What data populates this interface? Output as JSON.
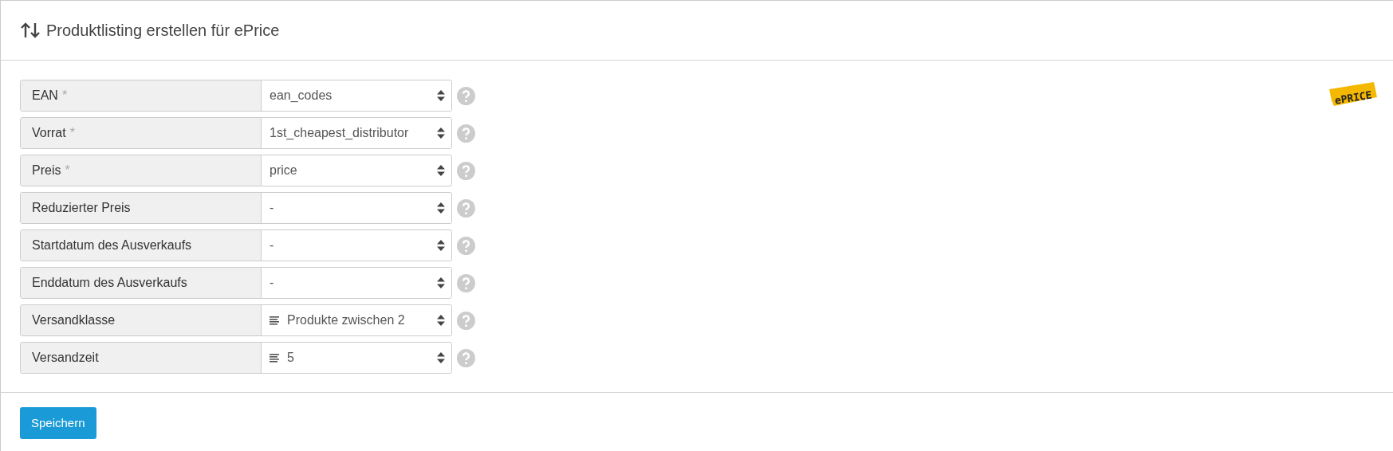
{
  "title": "Produktlisting erstellen für ePrice",
  "logo": {
    "text": "ePRICE"
  },
  "fields": [
    {
      "label": "EAN",
      "marker": "*",
      "value": "ean_codes",
      "kind": "column"
    },
    {
      "label": "Vorrat",
      "marker": "*",
      "value": "1st_cheapest_distributor",
      "kind": "column"
    },
    {
      "label": "Preis",
      "marker": "*",
      "value": "price",
      "kind": "column"
    },
    {
      "label": "Reduzierter Preis",
      "value": "-",
      "kind": "column"
    },
    {
      "label": "Startdatum des Ausverkaufs",
      "value": "-",
      "kind": "column"
    },
    {
      "label": "Enddatum des Ausverkaufs",
      "value": "-",
      "kind": "column"
    },
    {
      "label": "Versandklasse",
      "value": "Produkte zwischen 2",
      "kind": "list"
    },
    {
      "label": "Versandzeit",
      "value": "5",
      "kind": "list"
    }
  ],
  "save_button": "Speichern"
}
